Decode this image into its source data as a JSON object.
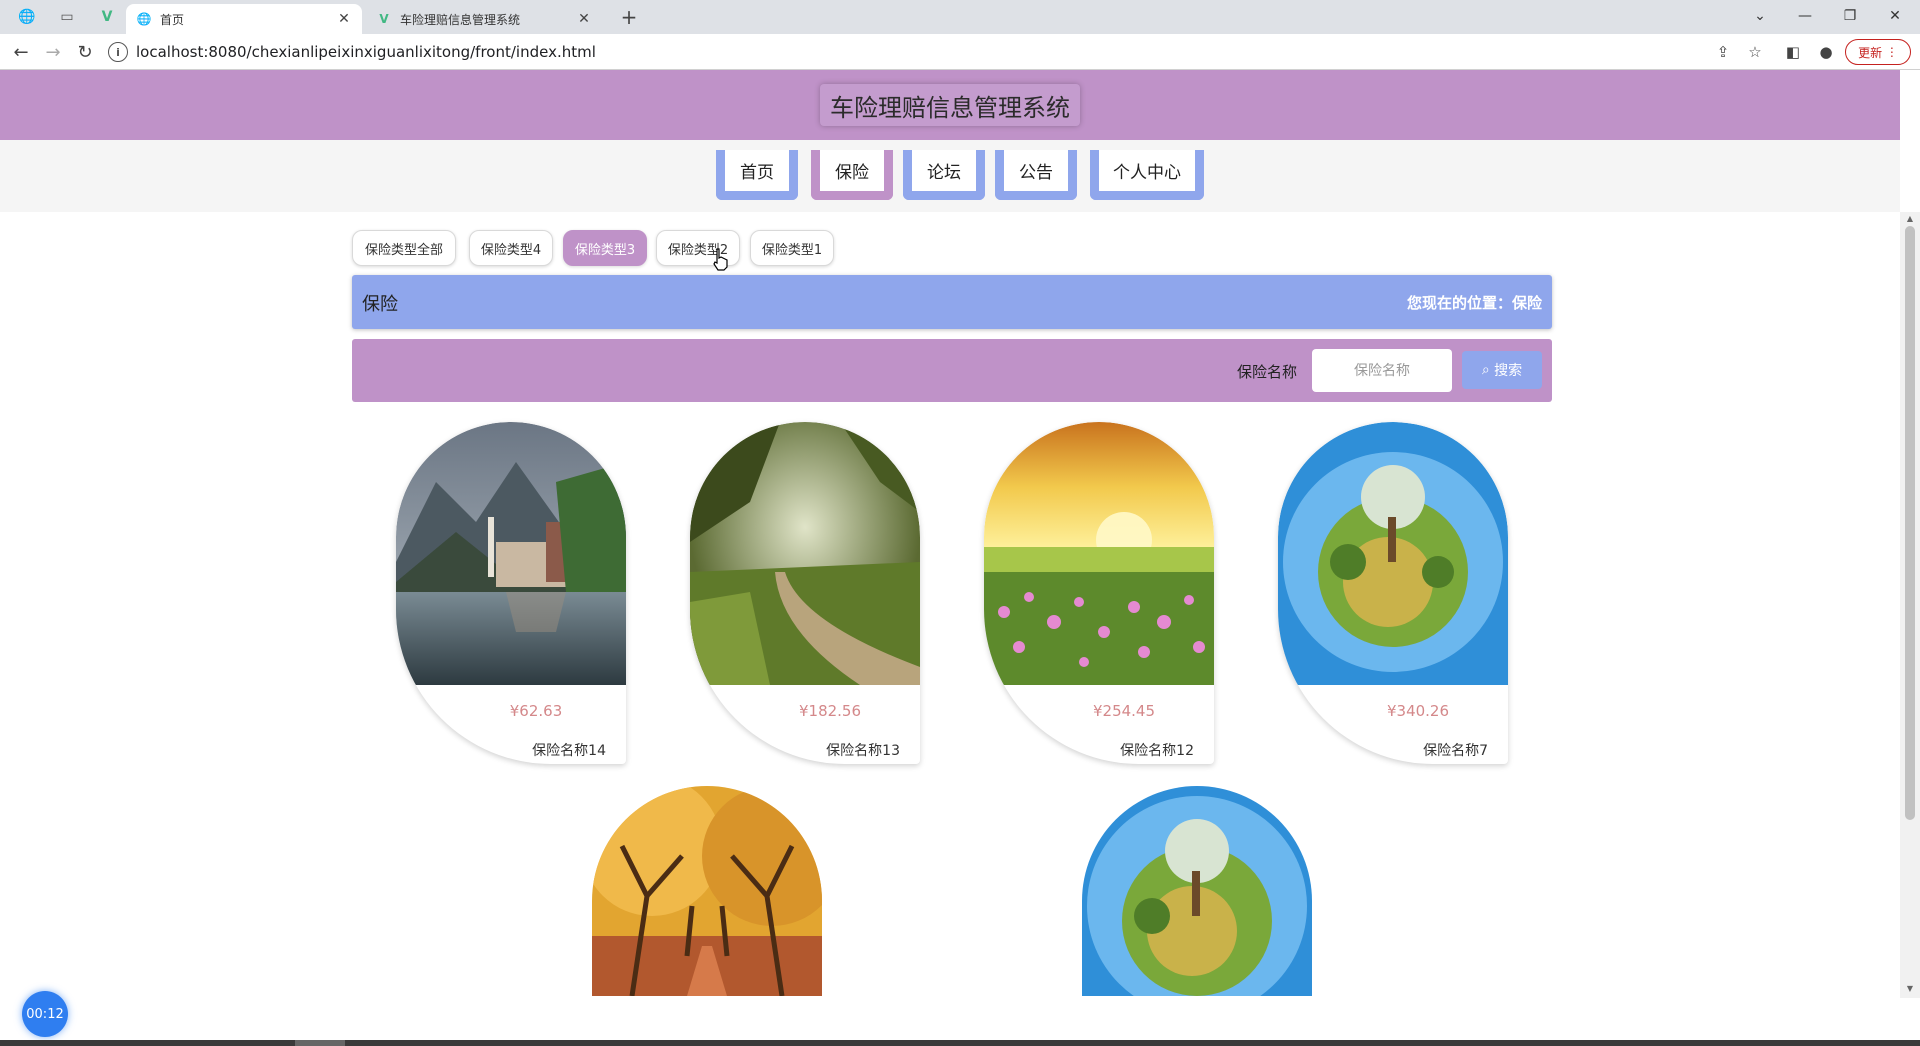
{
  "browser": {
    "tabs": [
      {
        "title": "首页",
        "active": true
      },
      {
        "title": "车险理赔信息管理系统",
        "active": false
      }
    ],
    "url": "localhost:8080/chexianlipeixinxiguanlixitong/front/index.html",
    "update_label": "更新"
  },
  "site": {
    "title": "车险理赔信息管理系统",
    "nav": [
      "首页",
      "保险",
      "论坛",
      "公告",
      "个人中心"
    ],
    "active_nav": "保险"
  },
  "categories": {
    "items": [
      "保险类型全部",
      "保险类型4",
      "保险类型3",
      "保险类型2",
      "保险类型1"
    ],
    "active": "保险类型3"
  },
  "page_bar": {
    "title": "保险",
    "location": "您现在的位置：保险"
  },
  "search": {
    "label": "保险名称",
    "placeholder": "保险名称",
    "button_label": "搜索"
  },
  "products": [
    {
      "price": "¥62.63",
      "name": "保险名称14",
      "image": "lake-village"
    },
    {
      "price": "¥182.56",
      "name": "保险名称13",
      "image": "forest-path"
    },
    {
      "price": "¥254.45",
      "name": "保险名称12",
      "image": "sunset-flowers"
    },
    {
      "price": "¥340.26",
      "name": "保险名称7",
      "image": "tiny-planet"
    },
    {
      "price": "",
      "name": "",
      "image": "autumn-trees"
    },
    {
      "price": "",
      "name": "",
      "image": "tiny-planet"
    }
  ],
  "timer": "00:12",
  "colors": {
    "purple": "#bf92c8",
    "blue": "#8fa6ec",
    "price": "#d4888a"
  }
}
